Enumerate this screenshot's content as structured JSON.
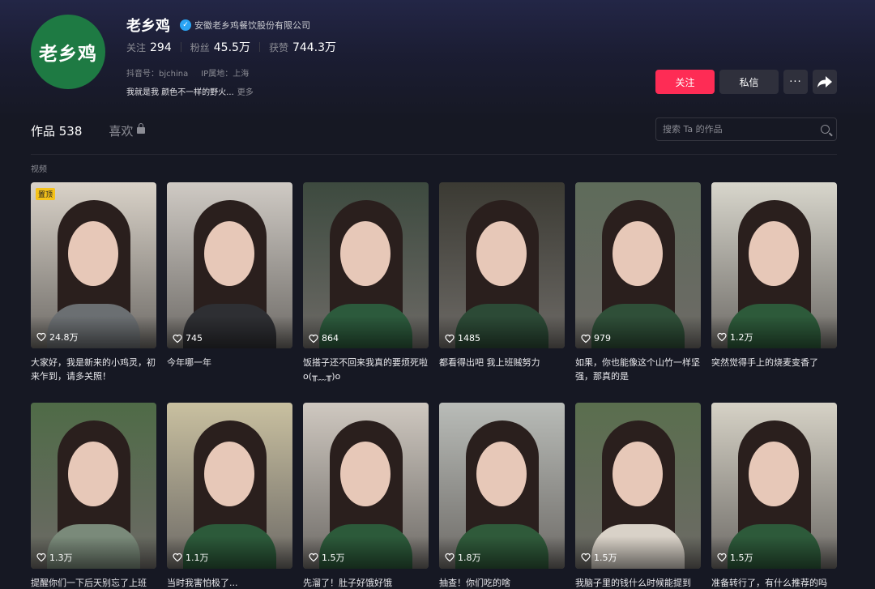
{
  "profile": {
    "avatar_text": "老乡鸡",
    "name": "老乡鸡",
    "verified_org": "安徽老乡鸡餐饮股份有限公司",
    "stats": [
      {
        "label": "关注",
        "value": "294"
      },
      {
        "label": "粉丝",
        "value": "45.5万"
      },
      {
        "label": "获赞",
        "value": "744.3万"
      }
    ],
    "douyin_id": "抖音号：bjchina",
    "ip_location": "IP属地：上海",
    "bio": "我就是我 颜色不一样的野火...",
    "bio_more": "更多"
  },
  "actions": {
    "follow": "关注",
    "message": "私信",
    "more": "···"
  },
  "tabs": {
    "works": "作品 538",
    "likes": "喜欢"
  },
  "search": {
    "placeholder": "搜索 Ta 的作品"
  },
  "section_label": "视频",
  "colors": {
    "accent": "#fe2c55",
    "background": "#161823",
    "brand_green": "#1e7a43"
  },
  "videos": [
    {
      "likes": "24.8万",
      "caption": "大家好，我是新来的小鸡灵，初来乍到，请多关照！",
      "pinned": "置顶"
    },
    {
      "likes": "745",
      "caption": "今年哪一年"
    },
    {
      "likes": "864",
      "caption": "饭搭子还不回来我真的要烦死啦 o(╥﹏╥)o"
    },
    {
      "likes": "1485",
      "caption": "都看得出吧 我上班贼努力"
    },
    {
      "likes": "979",
      "caption": "如果，你也能像这个山竹一样坚强，那真的是"
    },
    {
      "likes": "1.2万",
      "caption": "突然觉得手上的烧麦变香了"
    },
    {
      "likes": "1.3万",
      "caption": "提醒你们一下后天别忘了上班"
    },
    {
      "likes": "1.1万",
      "caption": "当时我害怕极了..."
    },
    {
      "likes": "1.5万",
      "caption": "先溜了！肚子好饿好饿"
    },
    {
      "likes": "1.8万",
      "caption": "抽查！你们吃的啥"
    },
    {
      "likes": "1.5万",
      "caption": "我脑子里的钱什么时候能提到"
    },
    {
      "likes": "1.5万",
      "caption": "准备转行了，有什么推荐的吗"
    }
  ]
}
